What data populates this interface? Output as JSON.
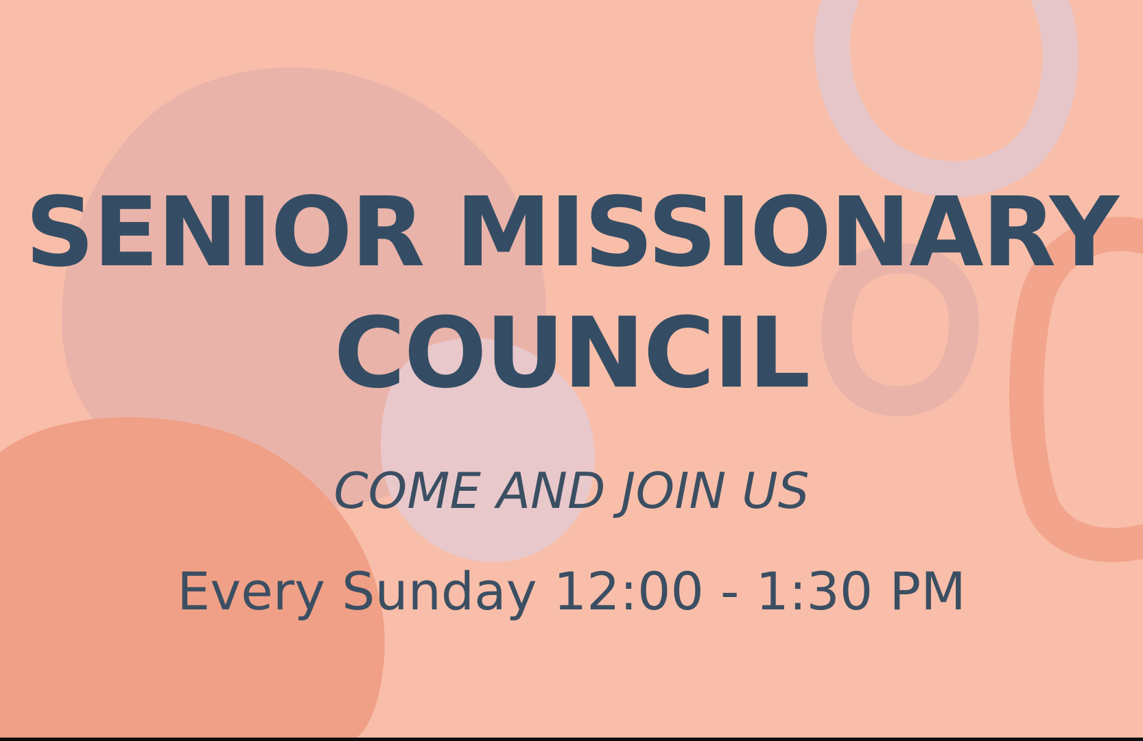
{
  "poster": {
    "title_line_1": "SENIOR MISSIONARY",
    "title_line_2": "COUNCIL",
    "subtitle": "COME AND JOIN US",
    "schedule": "Every Sunday 12:00 - 1:30 PM"
  },
  "colors": {
    "background": "#f9bea9",
    "title_text": "#344d64",
    "body_text": "#3b4f63",
    "blob_mauve": "#e9b3aa",
    "blob_coral": "#f0a086",
    "blob_lilac": "#e8c8cb",
    "ring_coral": "#f2a58c",
    "ring_lilac": "#e6c6c9"
  }
}
